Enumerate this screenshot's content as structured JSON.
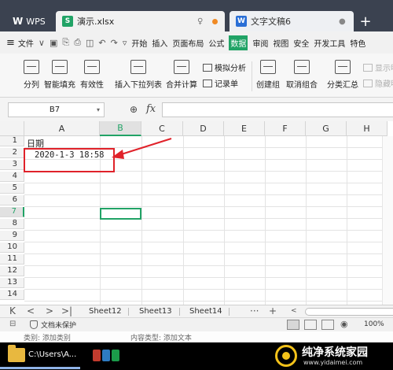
{
  "titlebar": {
    "wps_label": "WPS",
    "xlsx_tab": "演示.xlsx",
    "doc_tab": "文字文稿6",
    "new_tab": "+"
  },
  "menubar": {
    "hamburger": "≡",
    "file": "文件",
    "items": [
      "开始",
      "插入",
      "页面布局",
      "公式",
      "数据",
      "审阅",
      "视图",
      "安全",
      "开发工具",
      "特色"
    ],
    "active_item": "数据"
  },
  "ribbon": {
    "split": "分列",
    "smart_fill": "智能填充",
    "validity": "有效性",
    "insert_dropdown": "插入下拉列表",
    "consolidate": "合并计算",
    "simulate": "模拟分析",
    "record": "记录单",
    "create_group": "创建组",
    "ungroup": "取消组合",
    "subtotal": "分类汇总",
    "show_detail": "显示明",
    "hide_detail": "隐藏明"
  },
  "formula_bar": {
    "cell_ref": "B7",
    "fx": "fx",
    "value": ""
  },
  "sheet": {
    "columns": [
      "A",
      "B",
      "C",
      "D",
      "E",
      "F",
      "G",
      "H"
    ],
    "selected_column": "B",
    "rows": [
      "1",
      "2",
      "3",
      "4",
      "5",
      "6",
      "7",
      "8",
      "9",
      "10",
      "11",
      "12",
      "13",
      "14"
    ],
    "selected_row": "7",
    "cells": {
      "A1": "日期",
      "A2": "2020-1-3 18:58"
    }
  },
  "sheet_tabs": {
    "tabs": [
      "Sheet12",
      "Sheet13",
      "Sheet14"
    ],
    "add": "+"
  },
  "statusbar": {
    "protect": "文档未保护",
    "zoom": "100%"
  },
  "infostrip": {
    "category": "类别: 添加类别",
    "content_type": "内容类型: 添加文本"
  },
  "taskbar": {
    "path": "C:\\Users\\A..."
  },
  "watermark": {
    "name": "纯净系统家园",
    "url": "www.yidaimei.com"
  },
  "colors": {
    "accent_green": "#21a366",
    "annotation_red": "#e0222a",
    "titlebar_bg": "#3b4250"
  }
}
